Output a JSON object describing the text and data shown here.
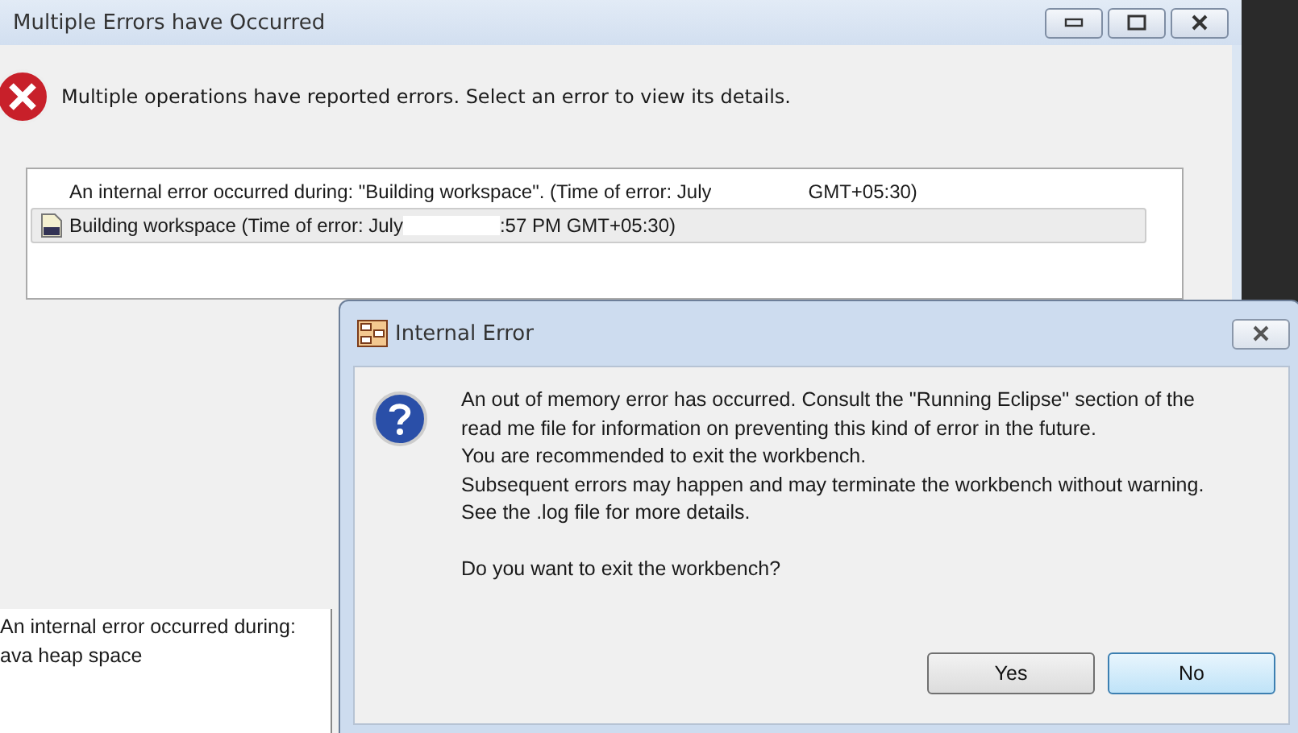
{
  "main_window": {
    "title": "Multiple Errors have Occurred",
    "message": "Multiple operations have reported errors. Select an error to view its details.",
    "errors": [
      {
        "text_before": "An internal error occurred during: \"Building workspace\". (Time of error: July",
        "text_after": "GMT+05:30)",
        "selected": false
      },
      {
        "text_before": "Building workspace (Time of error: July",
        "text_after": ":57 PM GMT+05:30)",
        "selected": true
      }
    ],
    "details": [
      "An internal error occurred during:",
      "ava heap space"
    ]
  },
  "dialog": {
    "title": "Internal Error",
    "message_lines": [
      "An out of memory error has occurred. Consult the \"Running Eclipse\" section of the",
      "read me file for information on preventing this kind of error in the future.",
      "You are recommended to exit the workbench.",
      "Subsequent errors may happen and may terminate the workbench without warning.",
      "See the .log file for more details."
    ],
    "question": "Do you want to exit the workbench?",
    "buttons": [
      {
        "label": "Yes",
        "selected": false
      },
      {
        "label": "No",
        "selected": true
      }
    ]
  }
}
